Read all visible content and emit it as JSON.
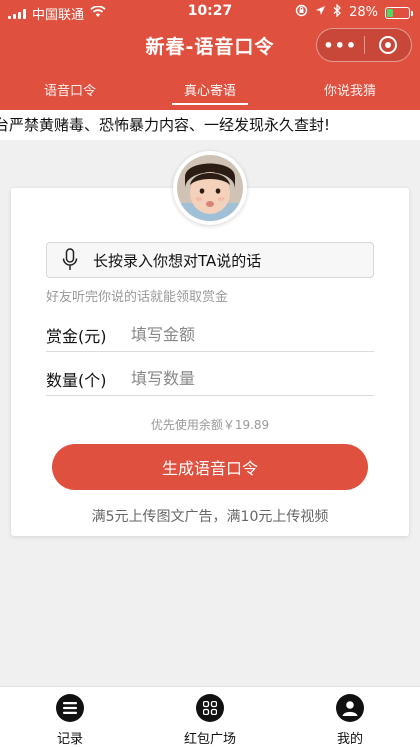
{
  "status_bar": {
    "carrier": "中国联通",
    "time": "10:27",
    "battery_percent": "28%",
    "battery_level": 0.28,
    "icons": [
      "signal-icon",
      "wifi-icon",
      "orientation-lock-icon",
      "location-icon",
      "bluetooth-icon",
      "battery-icon"
    ]
  },
  "header": {
    "title": "新春-语音口令",
    "capsule_more": "•••",
    "bg_color": "#e0503f"
  },
  "tabs": [
    {
      "label": "语音口令",
      "active": false
    },
    {
      "label": "真心寄语",
      "active": true
    },
    {
      "label": "你说我猜",
      "active": false
    }
  ],
  "notice": "台严禁黄赌毒、恐怖暴力内容、一经发现永久查封!",
  "form": {
    "voice_label": "长按录入你想对TA说的话",
    "hint": "好友听完你说的话就能领取赏金",
    "amount_label": "赏金(元)",
    "amount_placeholder": "填写金额",
    "count_label": "数量(个)",
    "count_placeholder": "填写数量",
    "balance_text": "优先使用余额￥19.89",
    "submit_label": "生成语音口令",
    "ad_note": "满5元上传图文广告，满10元上传视频"
  },
  "bottom_nav": [
    {
      "label": "记录",
      "icon": "list-icon"
    },
    {
      "label": "红包广场",
      "icon": "grid-icon"
    },
    {
      "label": "我的",
      "icon": "user-icon"
    }
  ]
}
